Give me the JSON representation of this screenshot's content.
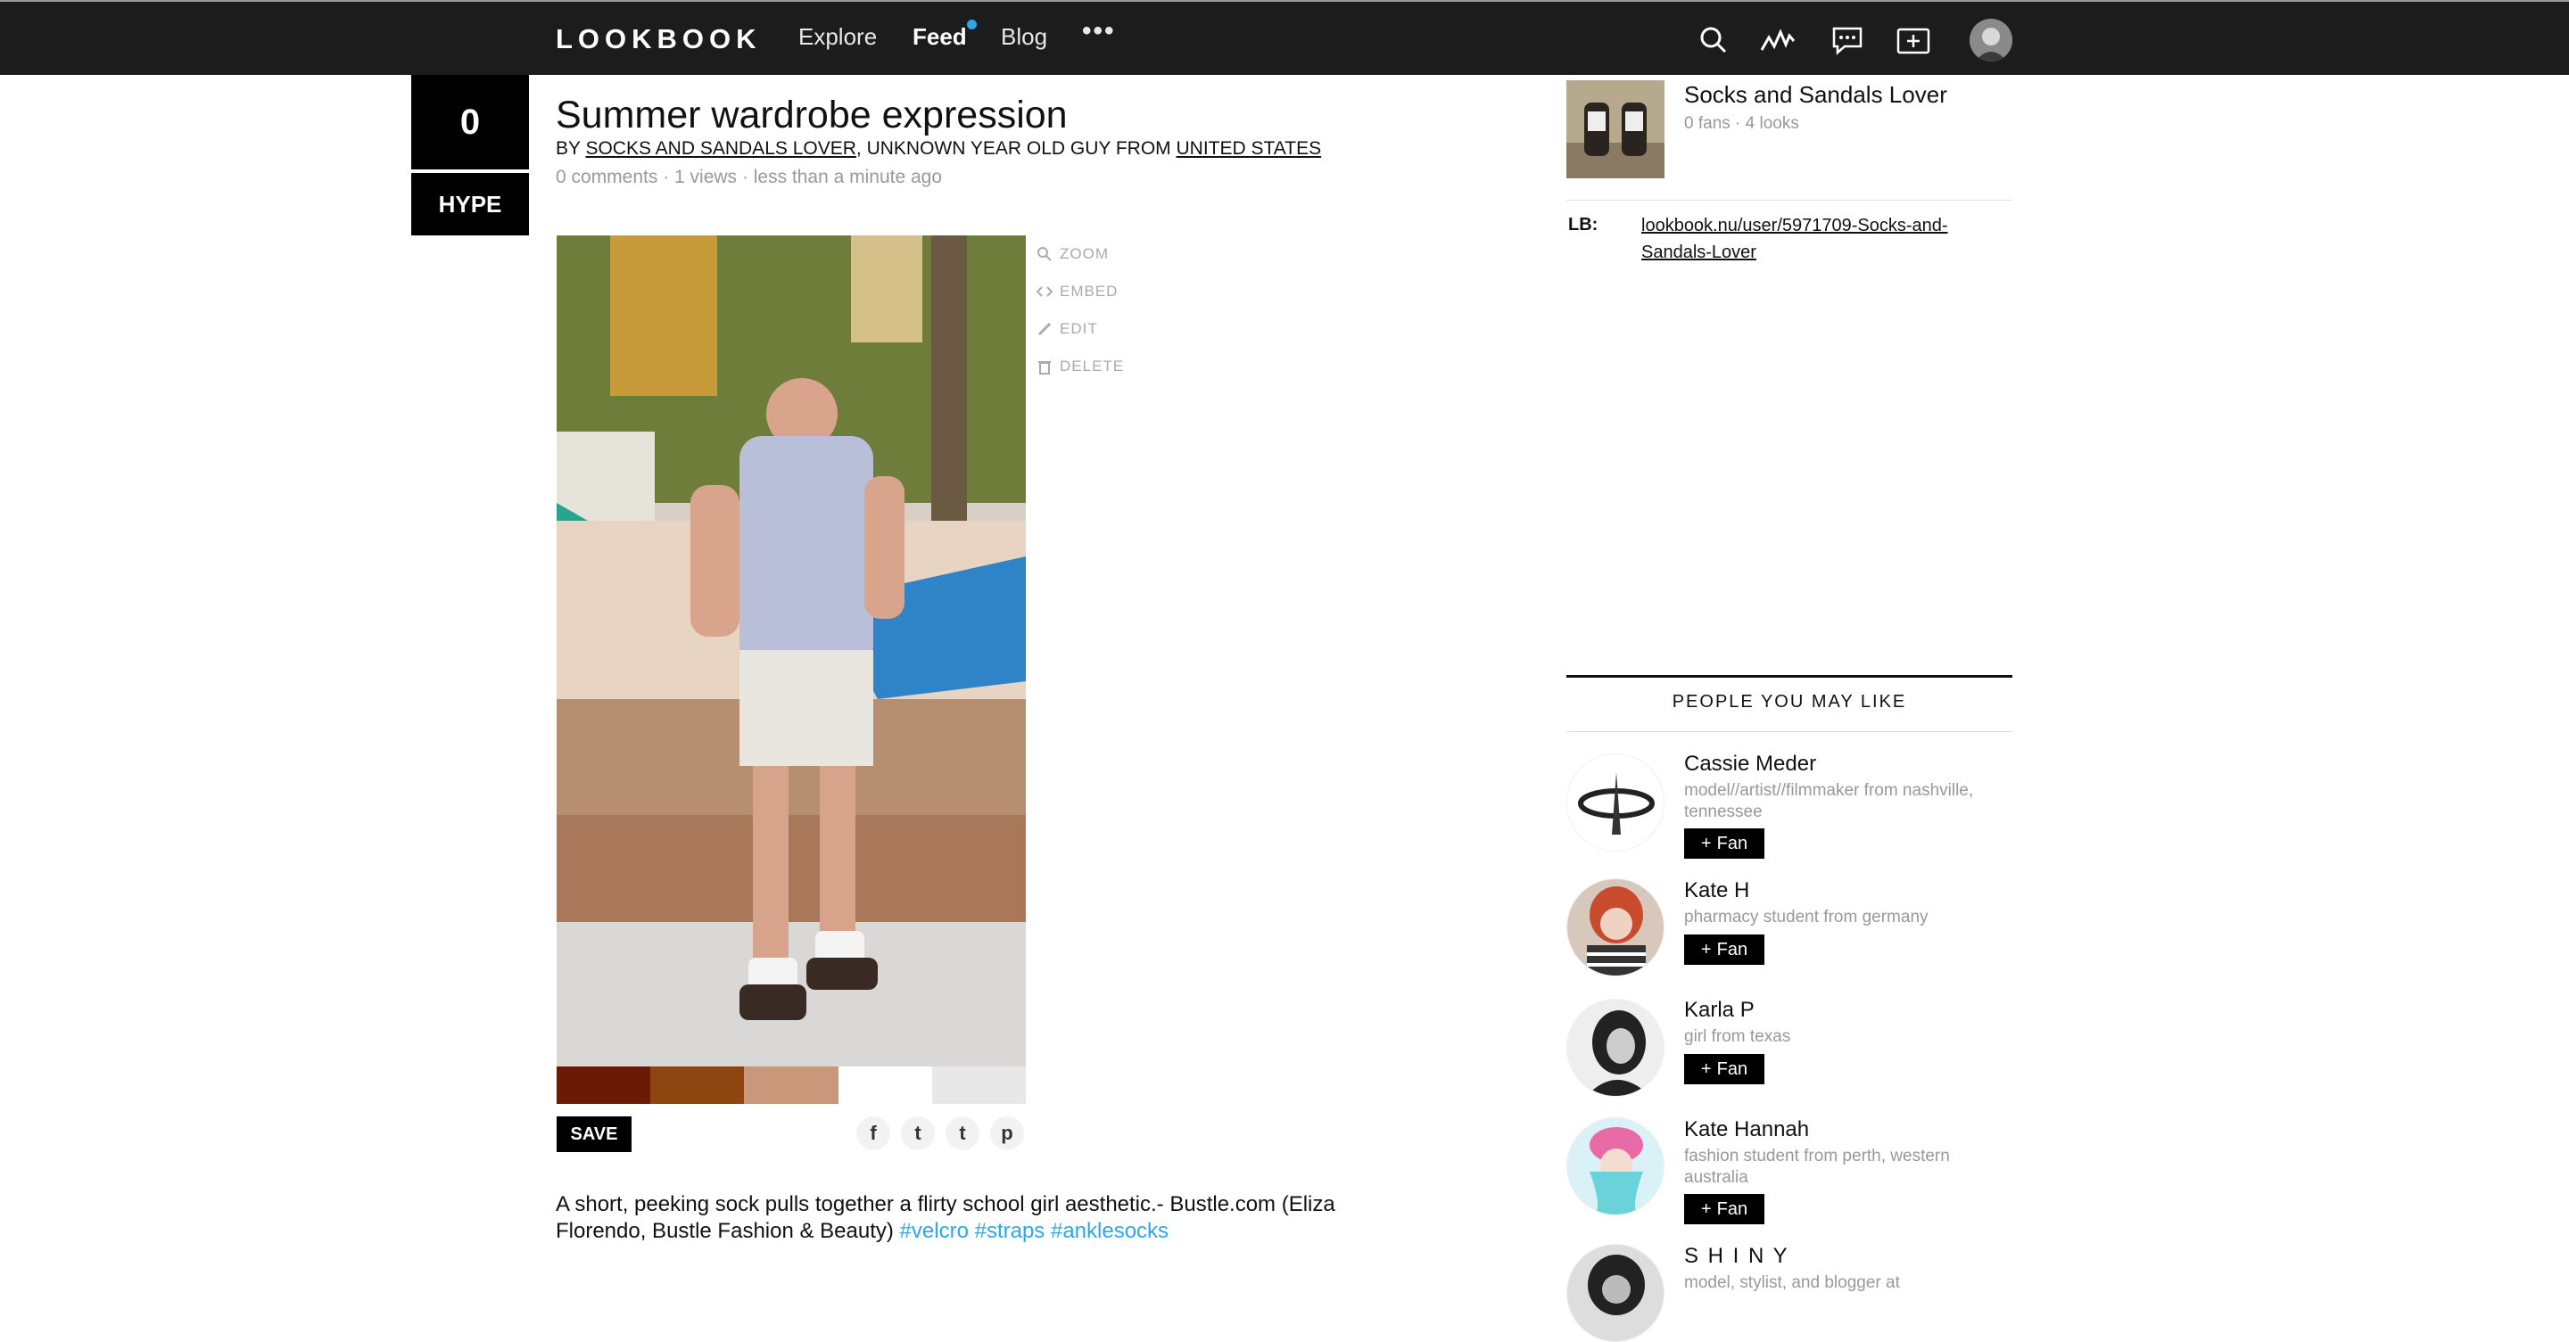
{
  "nav": {
    "logo": "LOOKBOOK",
    "explore": "Explore",
    "feed": "Feed",
    "blog": "Blog",
    "more": "•••",
    "icons": [
      "search-icon",
      "activity-icon",
      "messages-icon",
      "add-look-icon",
      "user-avatar"
    ]
  },
  "hype": {
    "count": "0",
    "label": "HYPE"
  },
  "look": {
    "title": "Summer wardrobe expression",
    "by_prefix": "BY ",
    "author": "SOCKS AND SANDALS LOVER",
    "by_middle": ", UNKNOWN YEAR OLD GUY FROM ",
    "country": "UNITED STATES",
    "meta": "0 comments · 1 views · less than a minute ago",
    "actions": {
      "zoom": "ZOOM",
      "embed": "EMBED",
      "edit": "EDIT",
      "delete": "DELETE"
    },
    "swatches": [
      "#6b1a06",
      "#8e450f",
      "#c9977a",
      "#ffffff",
      "#e8e8e8"
    ],
    "save": "SAVE",
    "share_icons": [
      "facebook-icon",
      "twitter-icon",
      "tumblr-icon",
      "pinterest-icon"
    ],
    "share_glyphs": {
      "facebook": "f",
      "twitter": "t",
      "tumblr": "t",
      "pinterest": "p"
    },
    "description": "A short, peeking sock pulls together a flirty school girl aesthetic.- Bustle.com (Eliza Florendo, Bustle Fashion & Beauty)",
    "tags": [
      "#velcro",
      "#straps",
      "#anklesocks"
    ]
  },
  "owner": {
    "name": "Socks and Sandals Lover",
    "stats": "0 fans · 4 looks",
    "lb_label": "LB:",
    "lb_link": "lookbook.nu/user/5971709-Socks-and-Sandals-Lover"
  },
  "people_title": "PEOPLE YOU MAY LIKE",
  "fan_label": "Fan",
  "fan_plus": "+",
  "people": [
    {
      "name": "Cassie Meder",
      "desc": "model//artist//filmmaker from nashville, tennessee"
    },
    {
      "name": "Kate H",
      "desc": "pharmacy student from germany"
    },
    {
      "name": "Karla P",
      "desc": "girl from texas"
    },
    {
      "name": "Kate Hannah",
      "desc": "fashion student from perth, western australia"
    },
    {
      "name": "S H I N Y",
      "desc": "model, stylist, and blogger at"
    }
  ]
}
